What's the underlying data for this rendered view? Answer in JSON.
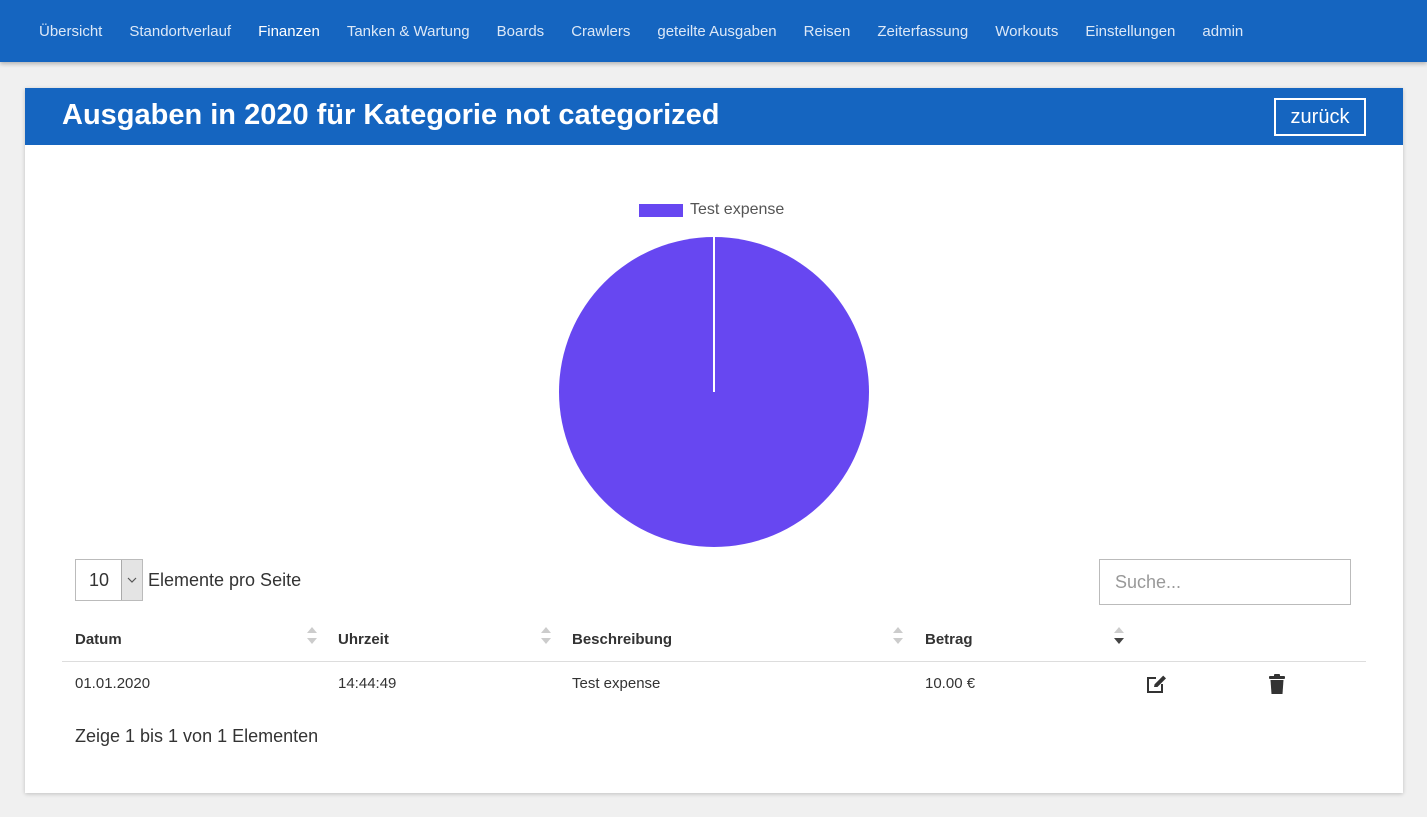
{
  "nav": {
    "items": [
      {
        "label": "Übersicht",
        "active": false
      },
      {
        "label": "Standortverlauf",
        "active": false
      },
      {
        "label": "Finanzen",
        "active": true
      },
      {
        "label": "Tanken & Wartung",
        "active": false
      },
      {
        "label": "Boards",
        "active": false
      },
      {
        "label": "Crawlers",
        "active": false
      },
      {
        "label": "geteilte Ausgaben",
        "active": false
      },
      {
        "label": "Reisen",
        "active": false
      },
      {
        "label": "Zeiterfassung",
        "active": false
      },
      {
        "label": "Workouts",
        "active": false
      },
      {
        "label": "Einstellungen",
        "active": false
      },
      {
        "label": "admin",
        "active": false
      }
    ]
  },
  "header": {
    "title": "Ausgaben in 2020 für Kategorie not categorized",
    "back_label": "zurück"
  },
  "colors": {
    "brand": "#1565c0",
    "pie_slice": "#6747f1"
  },
  "chart_data": {
    "type": "pie",
    "categories": [
      "Test expense"
    ],
    "values": [
      10.0
    ],
    "legend": "top"
  },
  "table": {
    "page_length": "10",
    "page_length_label": "Elemente pro Seite",
    "search_placeholder": "Suche...",
    "columns": [
      "Datum",
      "Uhrzeit",
      "Beschreibung",
      "Betrag"
    ],
    "rows": [
      {
        "datum": "01.01.2020",
        "uhrzeit": "14:44:49",
        "beschreibung": "Test expense",
        "betrag": "10.00 €"
      }
    ],
    "info": "Zeige 1 bis 1 von 1 Elementen"
  }
}
